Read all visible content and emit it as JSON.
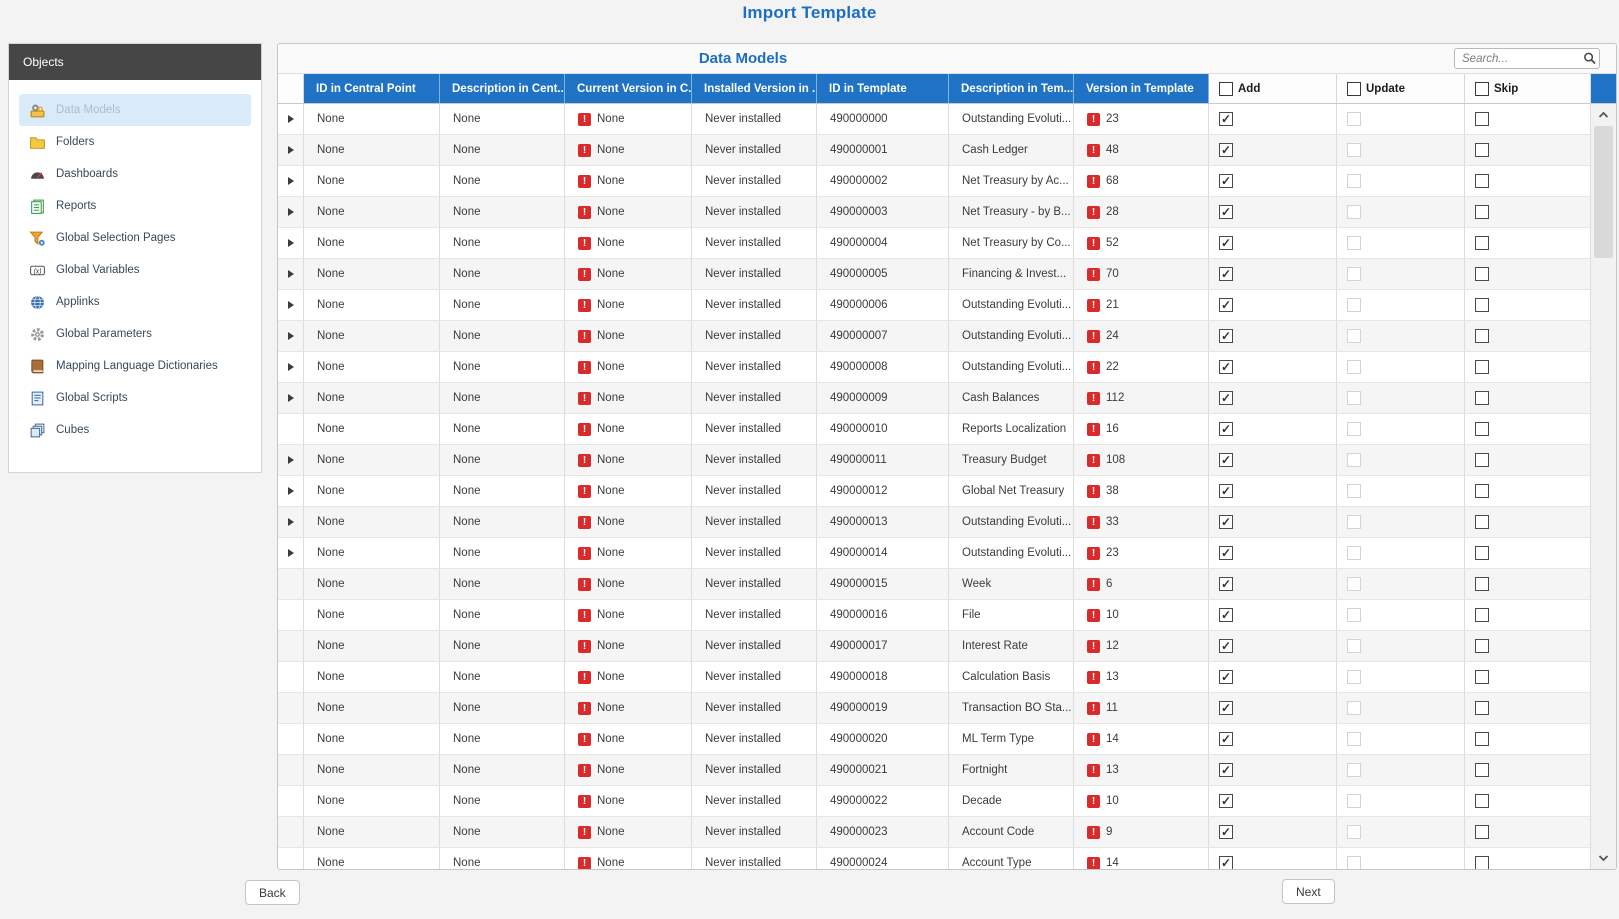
{
  "page_title": "Import Template",
  "colors": {
    "accent_blue": "#1f72c4",
    "title_blue": "#1b6ec2",
    "selected_item_bg": "#d9eaf8",
    "error_red": "#d92b2b",
    "row_alt": "#f5f5f5",
    "sidebar_header_bg": "#464646"
  },
  "sidebar": {
    "header": "Objects",
    "selected_index": 0,
    "items": [
      {
        "label": "Data Models",
        "icon": "data-models"
      },
      {
        "label": "Folders",
        "icon": "folders"
      },
      {
        "label": "Dashboards",
        "icon": "dashboards"
      },
      {
        "label": "Reports",
        "icon": "reports"
      },
      {
        "label": "Global Selection Pages",
        "icon": "global-selection-pages"
      },
      {
        "label": "Global Variables",
        "icon": "global-variables"
      },
      {
        "label": "Applinks",
        "icon": "applinks"
      },
      {
        "label": "Global Parameters",
        "icon": "global-parameters"
      },
      {
        "label": "Mapping Language Dictionaries",
        "icon": "mapping-language-dictionaries"
      },
      {
        "label": "Global Scripts",
        "icon": "global-scripts"
      },
      {
        "label": "Cubes",
        "icon": "cubes"
      }
    ]
  },
  "table": {
    "caption": "Data Models",
    "search_placeholder": "Search...",
    "columns": [
      "ID in Central Point",
      "Description in Cent...",
      "Current Version in C...",
      "Installed Version in ...",
      "ID in Template",
      "Description in Tem...",
      "Version in Template"
    ],
    "check_columns": [
      "Add",
      "Update",
      "Skip"
    ],
    "rows": [
      {
        "expander": true,
        "id_cp": "None",
        "desc_cp": "None",
        "cur_ver": "None",
        "installed": "Never installed",
        "id_tpl": "490000000",
        "desc_tpl": "Outstanding Evoluti...",
        "ver_tpl": "23",
        "add": "checked",
        "update": "unchecked-disabled",
        "skip": "unchecked"
      },
      {
        "expander": true,
        "id_cp": "None",
        "desc_cp": "None",
        "cur_ver": "None",
        "installed": "Never installed",
        "id_tpl": "490000001",
        "desc_tpl": "Cash Ledger",
        "ver_tpl": "48",
        "add": "checked",
        "update": "unchecked-disabled",
        "skip": "unchecked"
      },
      {
        "expander": true,
        "id_cp": "None",
        "desc_cp": "None",
        "cur_ver": "None",
        "installed": "Never installed",
        "id_tpl": "490000002",
        "desc_tpl": "Net Treasury by Ac...",
        "ver_tpl": "68",
        "add": "checked",
        "update": "unchecked-disabled",
        "skip": "unchecked"
      },
      {
        "expander": true,
        "id_cp": "None",
        "desc_cp": "None",
        "cur_ver": "None",
        "installed": "Never installed",
        "id_tpl": "490000003",
        "desc_tpl": "Net Treasury - by B...",
        "ver_tpl": "28",
        "add": "checked",
        "update": "unchecked-disabled",
        "skip": "unchecked"
      },
      {
        "expander": true,
        "id_cp": "None",
        "desc_cp": "None",
        "cur_ver": "None",
        "installed": "Never installed",
        "id_tpl": "490000004",
        "desc_tpl": "Net Treasury by Co...",
        "ver_tpl": "52",
        "add": "checked",
        "update": "unchecked-disabled",
        "skip": "unchecked"
      },
      {
        "expander": true,
        "id_cp": "None",
        "desc_cp": "None",
        "cur_ver": "None",
        "installed": "Never installed",
        "id_tpl": "490000005",
        "desc_tpl": "Financing & Invest...",
        "ver_tpl": "70",
        "add": "checked",
        "update": "unchecked-disabled",
        "skip": "unchecked"
      },
      {
        "expander": true,
        "id_cp": "None",
        "desc_cp": "None",
        "cur_ver": "None",
        "installed": "Never installed",
        "id_tpl": "490000006",
        "desc_tpl": "Outstanding Evoluti...",
        "ver_tpl": "21",
        "add": "checked",
        "update": "unchecked-disabled",
        "skip": "unchecked"
      },
      {
        "expander": true,
        "id_cp": "None",
        "desc_cp": "None",
        "cur_ver": "None",
        "installed": "Never installed",
        "id_tpl": "490000007",
        "desc_tpl": "Outstanding Evoluti...",
        "ver_tpl": "24",
        "add": "checked",
        "update": "unchecked-disabled",
        "skip": "unchecked"
      },
      {
        "expander": true,
        "id_cp": "None",
        "desc_cp": "None",
        "cur_ver": "None",
        "installed": "Never installed",
        "id_tpl": "490000008",
        "desc_tpl": "Outstanding Evoluti...",
        "ver_tpl": "22",
        "add": "checked",
        "update": "unchecked-disabled",
        "skip": "unchecked"
      },
      {
        "expander": true,
        "id_cp": "None",
        "desc_cp": "None",
        "cur_ver": "None",
        "installed": "Never installed",
        "id_tpl": "490000009",
        "desc_tpl": "Cash Balances",
        "ver_tpl": "112",
        "add": "checked",
        "update": "unchecked-disabled",
        "skip": "unchecked"
      },
      {
        "expander": false,
        "id_cp": "None",
        "desc_cp": "None",
        "cur_ver": "None",
        "installed": "Never installed",
        "id_tpl": "490000010",
        "desc_tpl": "Reports Localization",
        "ver_tpl": "16",
        "add": "checked",
        "update": "unchecked-disabled",
        "skip": "unchecked"
      },
      {
        "expander": true,
        "id_cp": "None",
        "desc_cp": "None",
        "cur_ver": "None",
        "installed": "Never installed",
        "id_tpl": "490000011",
        "desc_tpl": "Treasury Budget",
        "ver_tpl": "108",
        "add": "checked",
        "update": "unchecked-disabled",
        "skip": "unchecked"
      },
      {
        "expander": true,
        "id_cp": "None",
        "desc_cp": "None",
        "cur_ver": "None",
        "installed": "Never installed",
        "id_tpl": "490000012",
        "desc_tpl": "Global Net Treasury",
        "ver_tpl": "38",
        "add": "checked",
        "update": "unchecked-disabled",
        "skip": "unchecked"
      },
      {
        "expander": true,
        "id_cp": "None",
        "desc_cp": "None",
        "cur_ver": "None",
        "installed": "Never installed",
        "id_tpl": "490000013",
        "desc_tpl": "Outstanding Evoluti...",
        "ver_tpl": "33",
        "add": "checked",
        "update": "unchecked-disabled",
        "skip": "unchecked"
      },
      {
        "expander": true,
        "id_cp": "None",
        "desc_cp": "None",
        "cur_ver": "None",
        "installed": "Never installed",
        "id_tpl": "490000014",
        "desc_tpl": "Outstanding Evoluti...",
        "ver_tpl": "23",
        "add": "checked",
        "update": "unchecked-disabled",
        "skip": "unchecked"
      },
      {
        "expander": false,
        "id_cp": "None",
        "desc_cp": "None",
        "cur_ver": "None",
        "installed": "Never installed",
        "id_tpl": "490000015",
        "desc_tpl": "Week",
        "ver_tpl": "6",
        "add": "checked",
        "update": "unchecked-disabled",
        "skip": "unchecked"
      },
      {
        "expander": false,
        "id_cp": "None",
        "desc_cp": "None",
        "cur_ver": "None",
        "installed": "Never installed",
        "id_tpl": "490000016",
        "desc_tpl": "File",
        "ver_tpl": "10",
        "add": "checked",
        "update": "unchecked-disabled",
        "skip": "unchecked"
      },
      {
        "expander": false,
        "id_cp": "None",
        "desc_cp": "None",
        "cur_ver": "None",
        "installed": "Never installed",
        "id_tpl": "490000017",
        "desc_tpl": "Interest Rate",
        "ver_tpl": "12",
        "add": "checked",
        "update": "unchecked-disabled",
        "skip": "unchecked"
      },
      {
        "expander": false,
        "id_cp": "None",
        "desc_cp": "None",
        "cur_ver": "None",
        "installed": "Never installed",
        "id_tpl": "490000018",
        "desc_tpl": "Calculation Basis",
        "ver_tpl": "13",
        "add": "checked",
        "update": "unchecked-disabled",
        "skip": "unchecked"
      },
      {
        "expander": false,
        "id_cp": "None",
        "desc_cp": "None",
        "cur_ver": "None",
        "installed": "Never installed",
        "id_tpl": "490000019",
        "desc_tpl": "Transaction BO Sta...",
        "ver_tpl": "11",
        "add": "checked",
        "update": "unchecked-disabled",
        "skip": "unchecked"
      },
      {
        "expander": false,
        "id_cp": "None",
        "desc_cp": "None",
        "cur_ver": "None",
        "installed": "Never installed",
        "id_tpl": "490000020",
        "desc_tpl": "ML Term Type",
        "ver_tpl": "14",
        "add": "checked",
        "update": "unchecked-disabled",
        "skip": "unchecked"
      },
      {
        "expander": false,
        "id_cp": "None",
        "desc_cp": "None",
        "cur_ver": "None",
        "installed": "Never installed",
        "id_tpl": "490000021",
        "desc_tpl": "Fortnight",
        "ver_tpl": "13",
        "add": "checked",
        "update": "unchecked-disabled",
        "skip": "unchecked"
      },
      {
        "expander": false,
        "id_cp": "None",
        "desc_cp": "None",
        "cur_ver": "None",
        "installed": "Never installed",
        "id_tpl": "490000022",
        "desc_tpl": "Decade",
        "ver_tpl": "10",
        "add": "checked",
        "update": "unchecked-disabled",
        "skip": "unchecked"
      },
      {
        "expander": false,
        "id_cp": "None",
        "desc_cp": "None",
        "cur_ver": "None",
        "installed": "Never installed",
        "id_tpl": "490000023",
        "desc_tpl": "Account Code",
        "ver_tpl": "9",
        "add": "checked",
        "update": "unchecked-disabled",
        "skip": "unchecked"
      },
      {
        "expander": false,
        "id_cp": "None",
        "desc_cp": "None",
        "cur_ver": "None",
        "installed": "Never installed",
        "id_tpl": "490000024",
        "desc_tpl": "Account Type",
        "ver_tpl": "14",
        "add": "checked",
        "update": "unchecked-disabled",
        "skip": "unchecked"
      }
    ]
  },
  "footer": {
    "back_label": "Back",
    "next_label": "Next"
  }
}
